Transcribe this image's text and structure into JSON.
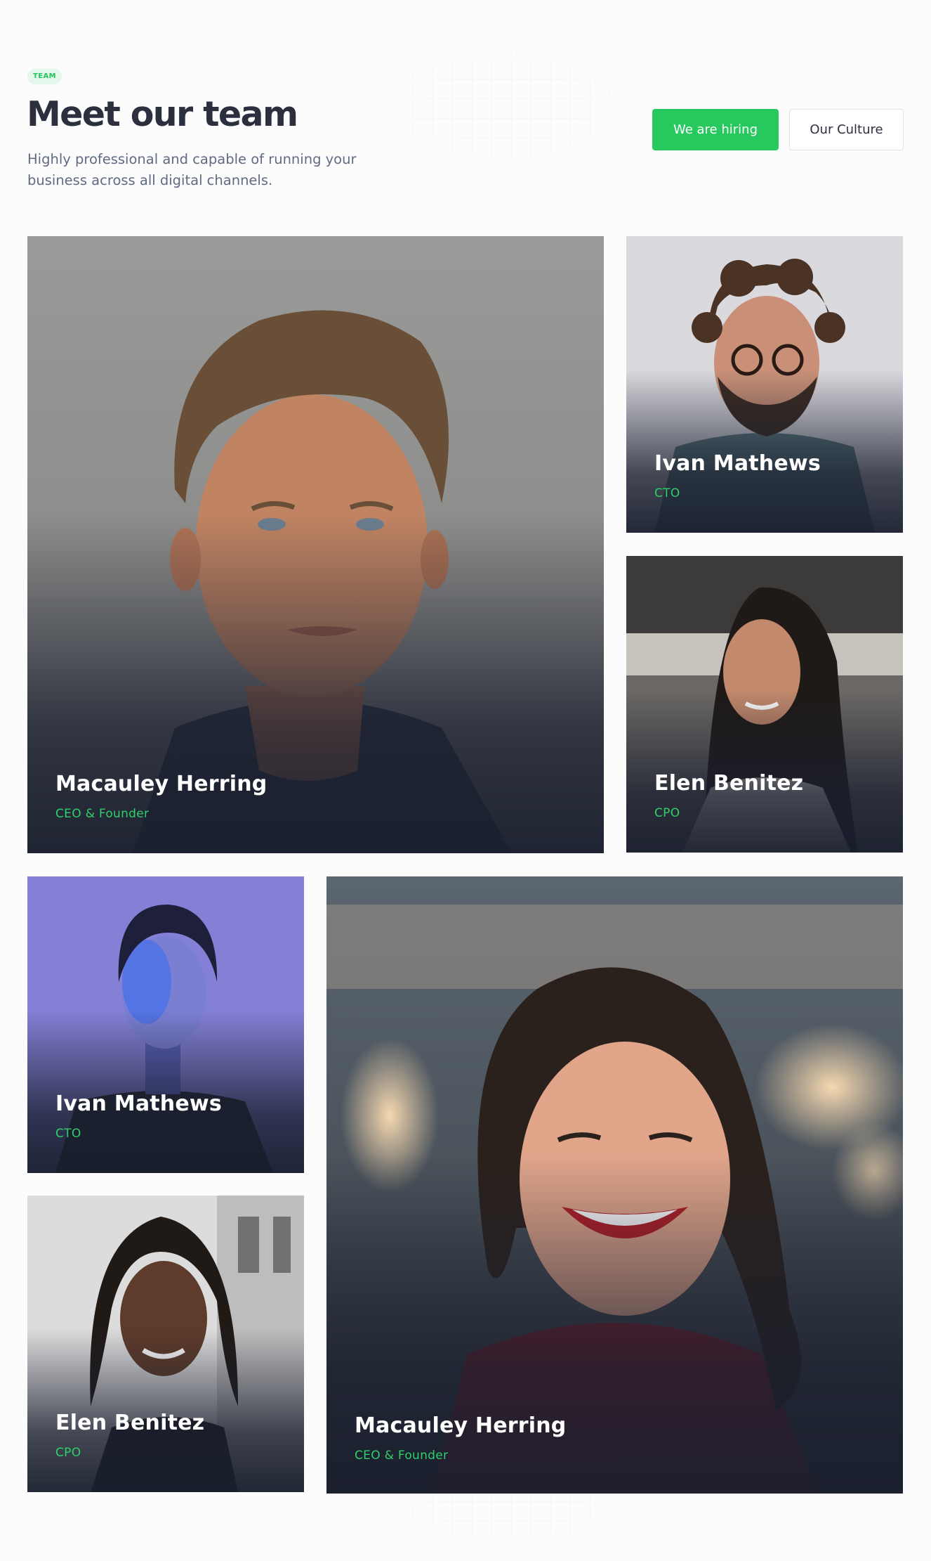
{
  "header": {
    "badge": "TEAM",
    "title": "Meet our team",
    "subtitle": "Highly professional and capable of running your business across all digital channels.",
    "primary_button": "We are hiring",
    "secondary_button": "Our Culture"
  },
  "members": [
    {
      "name": "Macauley Herring",
      "role": "CEO & Founder"
    },
    {
      "name": "Ivan Mathews",
      "role": "CTO"
    },
    {
      "name": "Elen Benitez",
      "role": "CPO"
    },
    {
      "name": "Ivan Mathews",
      "role": "CTO"
    },
    {
      "name": "Elen Benitez",
      "role": "CPO"
    },
    {
      "name": "Macauley Herring",
      "role": "CEO & Founder"
    }
  ],
  "colors": {
    "accent": "#27c95f",
    "role_text": "#2ed06a",
    "title": "#2b2f3e",
    "subtitle": "#606a82"
  }
}
